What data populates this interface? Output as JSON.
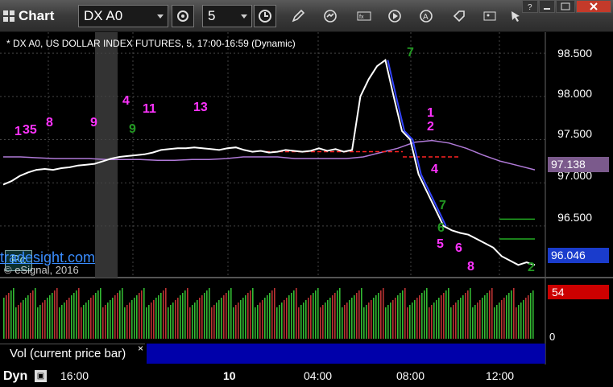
{
  "app": {
    "title": "Chart"
  },
  "toolbar": {
    "symbol": "DX A0",
    "interval": "5"
  },
  "chart": {
    "legend": "* DX A0, US DOLLAR INDEX FUTURES, 5, 17:00-16:59 (Dynamic)",
    "y_ticks": [
      "98.500",
      "98.000",
      "97.500",
      "97.000",
      "96.500"
    ],
    "last_close_label": "97.138",
    "last_price_label": "96.046",
    "pc_badge": "Pc",
    "tradesight": "tradesight.com",
    "copyright": "© eSignal, 2016",
    "colors": {
      "bg": "#000000",
      "price": "#ffffff",
      "dropline": "#3344ff",
      "ma": "#b07ad8",
      "count_magenta": "#ff33ff",
      "count_green": "#229922",
      "vol_up": "#33bb33",
      "vol_down": "#bb3333",
      "ref_red": "#ff2222"
    }
  },
  "volume": {
    "label": "Vol (current price bar)",
    "close_icon": "×",
    "value_label": "54",
    "zero_label": "0"
  },
  "xaxis": {
    "mode_label": "Dyn",
    "ticks": [
      "16:00",
      "10",
      "04:00",
      "08:00",
      "12:00"
    ]
  },
  "chart_data": {
    "type": "line",
    "title": "* DX A0, US DOLLAR INDEX FUTURES, 5, 17:00-16:59 (Dynamic)",
    "x_ticks": [
      "16:00",
      "10",
      "04:00",
      "08:00",
      "12:00"
    ],
    "y_ticks": [
      98.5,
      98.0,
      97.5,
      97.0,
      96.5
    ],
    "ylim": [
      95.95,
      98.65
    ],
    "series": [
      {
        "values": [
          96.98,
          97.02,
          97.08,
          97.12,
          97.15,
          97.16,
          97.15,
          97.17,
          97.18,
          97.2,
          97.21,
          97.22,
          97.25,
          97.28,
          97.3,
          97.31,
          97.32,
          97.33,
          97.35,
          97.38,
          97.39,
          97.4,
          97.4,
          97.41,
          97.4,
          97.39,
          97.38,
          97.4,
          97.41,
          97.38,
          97.36,
          97.37,
          97.35,
          97.36,
          97.38,
          97.37,
          97.36,
          97.37,
          97.4,
          97.37,
          97.39,
          97.36,
          97.38,
          98.0,
          98.2,
          98.35,
          98.42,
          98.0,
          97.6,
          97.5,
          97.1,
          96.9,
          96.7,
          96.5,
          96.45,
          96.42,
          96.4,
          96.35,
          96.3,
          96.25,
          96.15,
          96.1,
          96.05,
          96.08,
          96.05
        ]
      },
      {
        "values": [
          97.3,
          97.3,
          97.29,
          97.28,
          97.28,
          97.28,
          97.27,
          97.27,
          97.27,
          97.26,
          97.26,
          97.27,
          97.27,
          97.28,
          97.3,
          97.3,
          97.3,
          97.28,
          97.28,
          97.28,
          97.28,
          97.3,
          97.35,
          97.4,
          97.47,
          97.49,
          97.46,
          97.4,
          97.32,
          97.25,
          97.2,
          97.15
        ]
      }
    ],
    "count_labels": [
      {
        "text": "1",
        "color": "magenta"
      },
      {
        "text": "35",
        "color": "magenta"
      },
      {
        "text": "8",
        "color": "magenta"
      },
      {
        "text": "9",
        "color": "magenta"
      },
      {
        "text": "4",
        "color": "magenta"
      },
      {
        "text": "11",
        "color": "magenta"
      },
      {
        "text": "13",
        "color": "magenta"
      },
      {
        "text": "9",
        "color": "green"
      },
      {
        "text": "7",
        "color": "green"
      },
      {
        "text": "1",
        "color": "magenta"
      },
      {
        "text": "2",
        "color": "magenta"
      },
      {
        "text": "4",
        "color": "magenta"
      },
      {
        "text": "7",
        "color": "green"
      },
      {
        "text": "6",
        "color": "green"
      },
      {
        "text": "5",
        "color": "magenta"
      },
      {
        "text": "6",
        "color": "magenta"
      },
      {
        "text": "8",
        "color": "magenta"
      },
      {
        "text": "2",
        "color": "green"
      }
    ],
    "volume_value": 54
  }
}
